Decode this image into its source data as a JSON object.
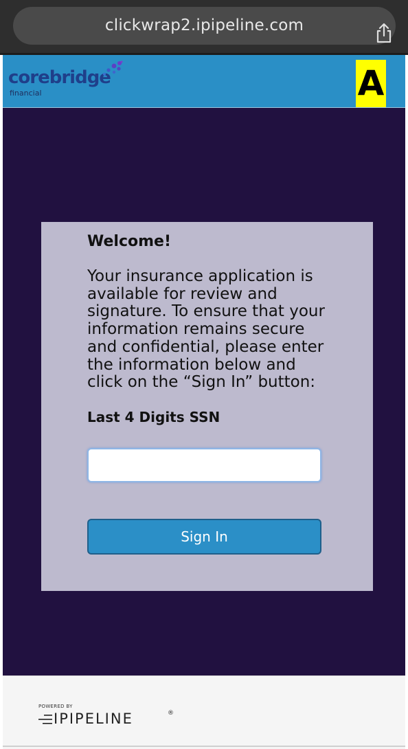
{
  "browser": {
    "url": "clickwrap2.ipipeline.com",
    "share_icon": "share-icon"
  },
  "header": {
    "brand_name": "corebridge",
    "brand_sub": "financial",
    "badge": "A",
    "colors": {
      "header_bg": "#2a8fc6",
      "badge_bg": "#ffff00"
    }
  },
  "card": {
    "welcome": "Welcome!",
    "intro": "Your insurance application is available for review and signature. To ensure that your information remains secure and confidential, please enter the information below and click on the “Sign In” button:",
    "ssn_label": "Last 4 Digits SSN",
    "ssn_value": "",
    "sign_in_label": "Sign In"
  },
  "footer": {
    "powered_by": "POWERED BY",
    "logo_text": "IPIPELINE",
    "reg_mark": "®"
  },
  "colors": {
    "page_bg": "#211140",
    "card_bg": "#bdbace",
    "button_bg": "#2b8fc7"
  }
}
